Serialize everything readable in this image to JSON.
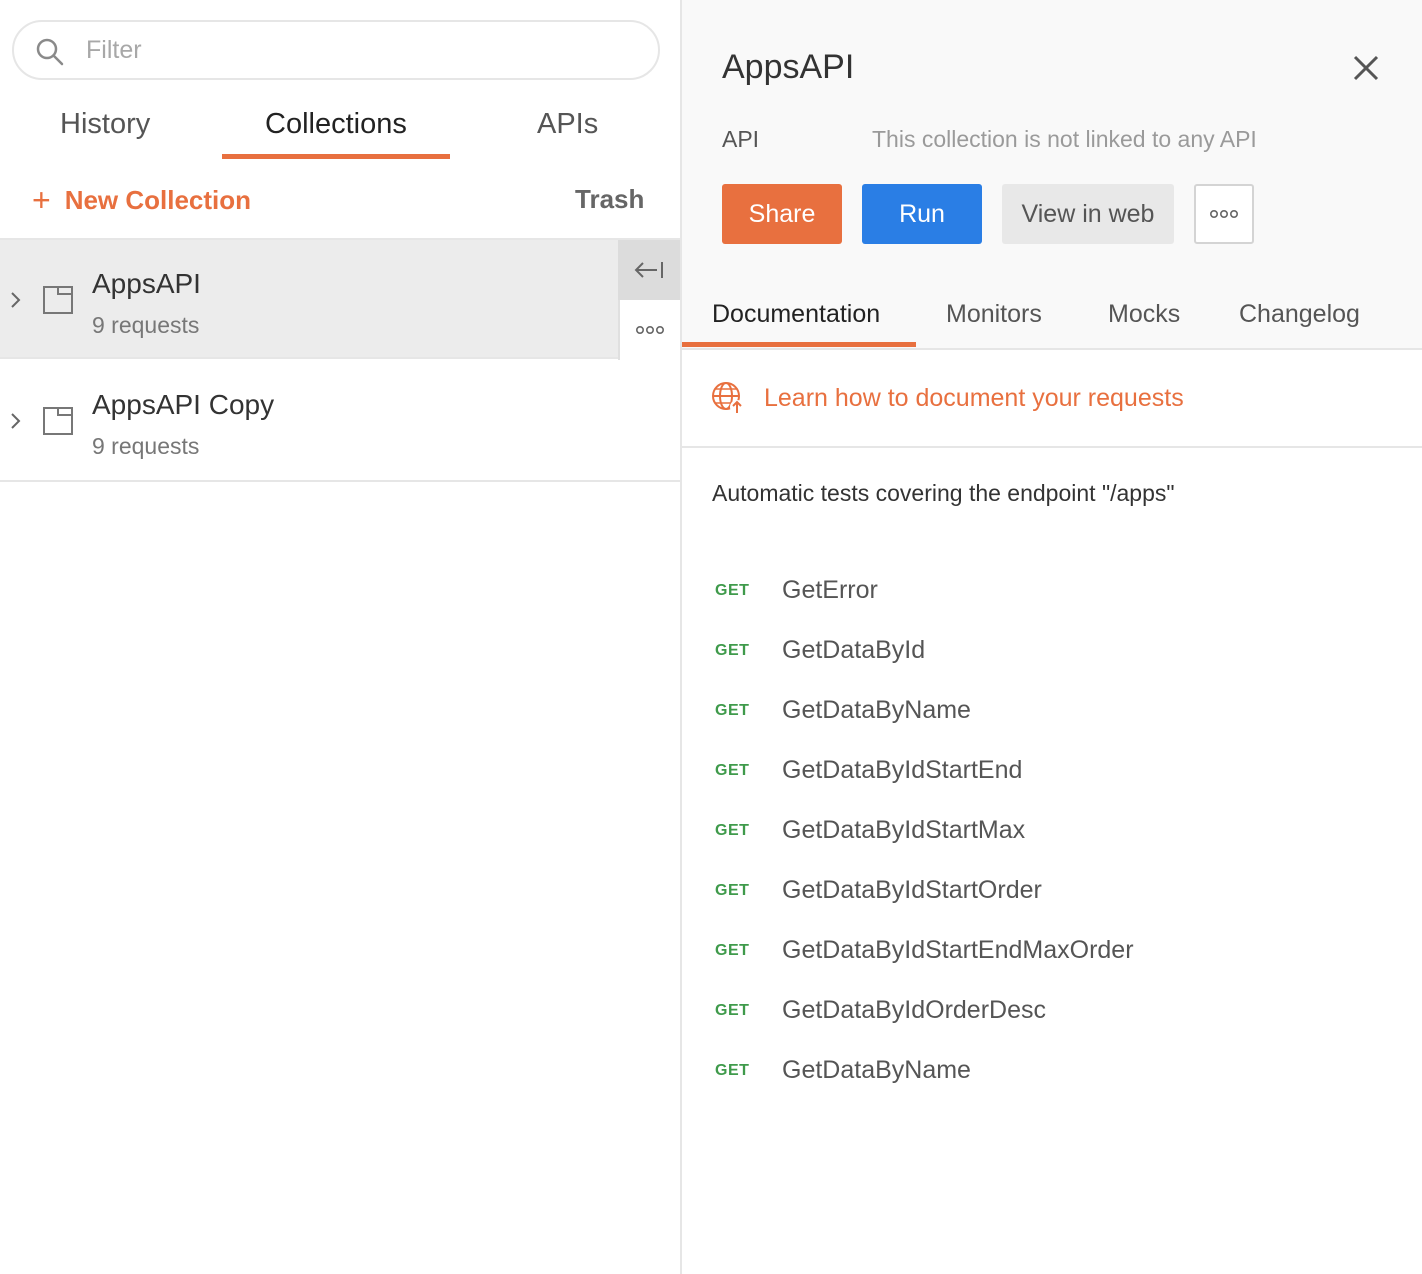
{
  "sidebar": {
    "filter_placeholder": "Filter",
    "tabs": [
      {
        "label": "History"
      },
      {
        "label": "Collections"
      },
      {
        "label": "APIs"
      }
    ],
    "new_collection_label": "New Collection",
    "trash_label": "Trash",
    "collections": [
      {
        "name": "AppsAPI",
        "count": "9 requests"
      },
      {
        "name": "AppsAPI Copy",
        "count": "9 requests"
      }
    ]
  },
  "detail": {
    "title": "AppsAPI",
    "api_label": "API",
    "api_value": "This collection is not linked to any API",
    "buttons": {
      "share": "Share",
      "run": "Run",
      "view_web": "View in web"
    },
    "tabs": [
      {
        "label": "Documentation"
      },
      {
        "label": "Monitors"
      },
      {
        "label": "Mocks"
      },
      {
        "label": "Changelog"
      }
    ],
    "learn_link": "Learn how to document your requests",
    "description": "Automatic tests covering the endpoint \"/apps\"",
    "requests": [
      {
        "method": "GET",
        "name": "GetError"
      },
      {
        "method": "GET",
        "name": "GetDataById"
      },
      {
        "method": "GET",
        "name": "GetDataByName"
      },
      {
        "method": "GET",
        "name": "GetDataByIdStartEnd"
      },
      {
        "method": "GET",
        "name": "GetDataByIdStartMax"
      },
      {
        "method": "GET",
        "name": "GetDataByIdStartOrder"
      },
      {
        "method": "GET",
        "name": "GetDataByIdStartEndMaxOrder"
      },
      {
        "method": "GET",
        "name": "GetDataByIdOrderDesc"
      },
      {
        "method": "GET",
        "name": "GetDataByName"
      }
    ]
  },
  "colors": {
    "accent": "#e8703f",
    "run": "#2a7ee5",
    "method_get": "#3f9a4b"
  }
}
